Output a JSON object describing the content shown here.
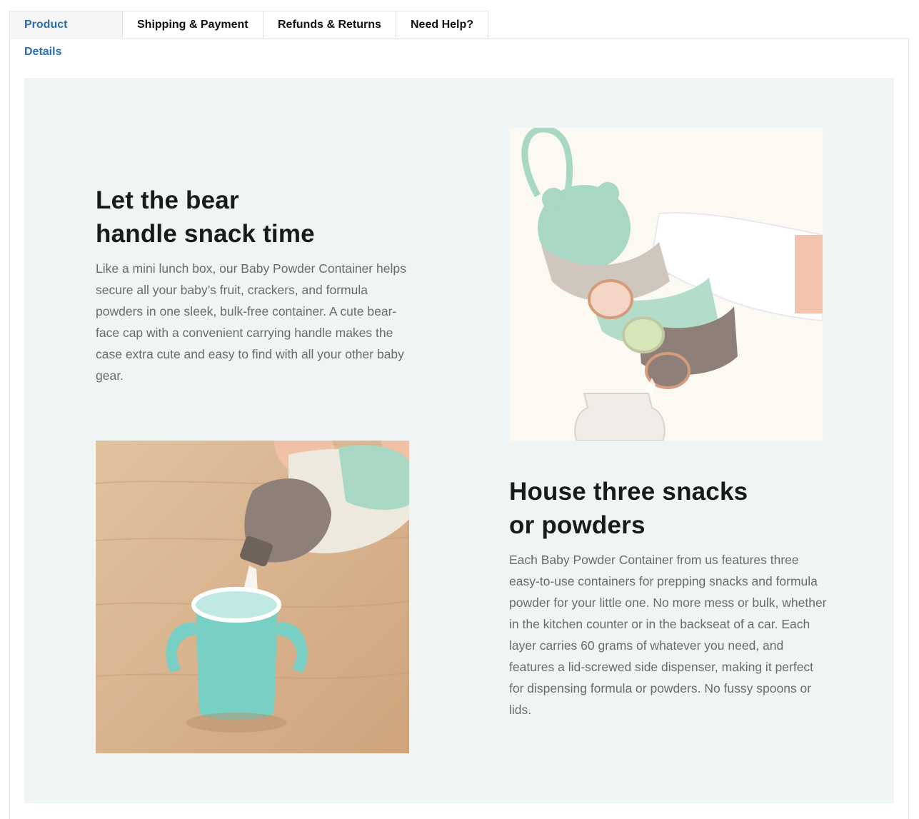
{
  "tabs": [
    {
      "label": "Product Details",
      "active": true
    },
    {
      "label": "Shipping & Payment",
      "active": false
    },
    {
      "label": "Refunds & Returns",
      "active": false
    },
    {
      "label": "Need Help?",
      "active": false
    }
  ],
  "sections": [
    {
      "heading_line1": "Let the bear",
      "heading_line2": "handle snack time",
      "body": "Like a mini lunch box, our Baby Powder Container helps secure all your baby’s fruit, crackers, and formula powders in one sleek, bulk-free container. A cute bear-face cap with a convenient carrying handle makes the case extra cute and easy to find with all your other baby gear."
    },
    {
      "heading_line1": "House three snacks",
      "heading_line2": "or powders",
      "body": "Each Baby Powder Container from us features three easy-to-use containers for prepping snacks and formula powder for your little one. No more mess or bulk, whether in the kitchen counter or in the backseat of a car. Each layer carries 60 grams of whatever you need, and features a lid-screwed side dispenser, making it perfect for dispensing formula or powders. No fussy spoons or lids."
    }
  ],
  "colors": {
    "active_tab_text": "#2a6db0",
    "content_background": "#eef5f4",
    "mint": "#a9d8c4",
    "taupe": "#8e8079"
  }
}
